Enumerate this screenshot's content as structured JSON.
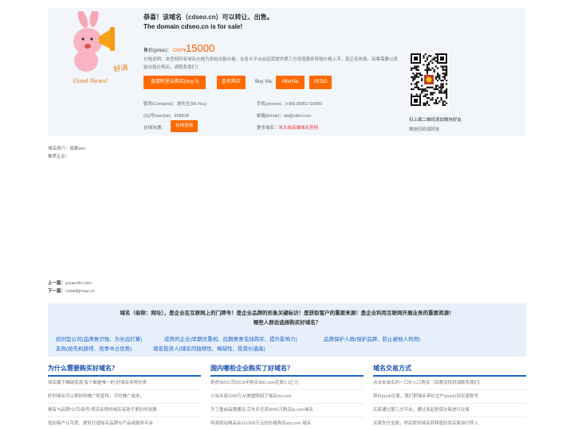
{
  "header": {
    "headline": "恭喜！该域名（cdseo.cn）可以转让、出售。",
    "headline_en": "The domain cdseo.cn is for sale!",
    "price_label": "售价(price)：",
    "price_currency": "CNY¥",
    "price_amount": "15000",
    "price_note": "价格说明：本官网所有域名价格为原始出售价格，在各大平台会因其提供第三方增值服务导致价格上浮，真正有效费。如果需要以原始出售价购买，请联系我们！",
    "mascot_caption": "Good News!",
    "mascot_sign": "好消息"
  },
  "buttons": {
    "aliyun": "直接阿里云购买(buy it)",
    "yumi": "金名购买",
    "buy_via": "Buy Via:",
    "afternic": "AfterNic",
    "sedo": "SEDO",
    "online": "在线咨询"
  },
  "contact": {
    "contacts_label": "联系(Contacts)：",
    "contacts_value": "游先生(Mr.You)",
    "phone_label": "手机(phone)：",
    "phone_value": "(+86)18981716800",
    "qq_label": "QQ号/wechat：",
    "qq_value": "958818",
    "email_label": "邮箱(Email)：",
    "email_value": "ab@cdef.com",
    "online_label": "在线沟通：",
    "more_label": "更多域名：",
    "more_value": "米大侠高端域名官网"
  },
  "qr": {
    "caption": "扫上面二维码添加微信好友",
    "scan_text": "微信扫码加好友"
  },
  "intro": {
    "domain_intro": "域名简介：成都seo",
    "recommend": "推荐企业："
  },
  "prevnext": {
    "prev_label": "上一篇：",
    "prev_value": "youershi.com",
    "next_label": "下一篇：",
    "next_value": "cowellgroup.cn"
  },
  "banner": {
    "line1": "域名（俗称：网址），是企业在互联网上的门牌号！是企业品牌的形象关键标识！是获取客户的重要来源！是企业利用互联网开展业务的重要资源！",
    "line2": "哪些人群会选择购买好域名？",
    "links": [
      "初创型公司(品牌意识强、为长远打算)",
      "成熟的企业(早期没重视、后期意意花钱购买、提升影响力)",
      "品牌保护人群(保护品牌、防止被他人利用)",
      "友商(抢先机获得、竞争中占优势)",
      "域名投资人(域名的独特性、稀缺性、投资价值高)"
    ]
  },
  "columns": [
    {
      "title": "为什么需要购买好域名？",
      "items": [
        "域名属于稀缺资源,有个都是唯一的,好域名非常珍贵.",
        "好的域名可以更好的推广和宣传，节约推广成本。",
        "拥有与品牌/公司/商号/项目名称的域名有助于更好的发展.",
        "增加客户认可度、更好打造知名品牌与产品或服务平台."
      ]
    },
    {
      "title": "国内哪些企业购买了好域名？",
      "items": [
        "奇虎360公司2015年购买360.com花费1.1亿元",
        "小米斥资2200万从美国购回了域名mi.com",
        "为了重启品牌建设,京东斥巨资3000万购买jd.com域名",
        "特卖网站唯品会以1200万元的价格购买vip.com 域名"
      ]
    },
    {
      "title": "域名交易方式",
      "items": [
        "点击本域名的一口价入口购买（如果没找到请联系我们）",
        "带价push交易，我们把域名带价过户(push)到买家账号.",
        "买家通过第三方平台，通过发起担保交易进行交易.",
        "买家先付全款，然后提供域名转移密码供买家自行转入."
      ]
    }
  ],
  "colors": {
    "accent_orange": "#ff6a00",
    "price_orange": "#ff5a00",
    "link_blue": "#1a62c9",
    "title_blue": "#1a4fae",
    "panel_bg": "#f2f5fa",
    "banner_bg": "#e7f0fa",
    "alert_red": "#e4393c"
  }
}
